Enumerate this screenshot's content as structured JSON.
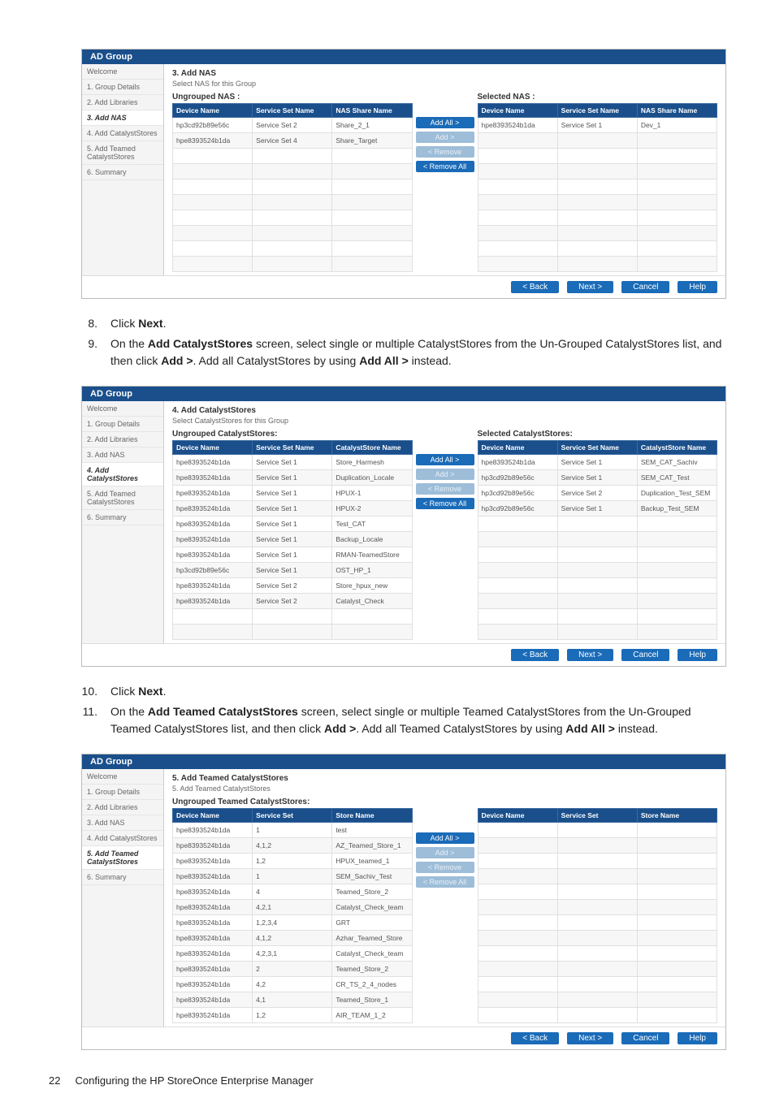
{
  "steps_text": {
    "s8_num": "8.",
    "s8_a": "Click ",
    "s8_b": "Next",
    "s8_c": ".",
    "s9_num": "9.",
    "s9_a": "On the ",
    "s9_b": "Add CatalystStores",
    "s9_c": " screen, select single or multiple CatalystStores from the Un-Grouped CatalystStores list, and then click ",
    "s9_d": "Add >",
    "s9_e": ". Add all CatalystStores by using ",
    "s9_f": "Add All >",
    "s9_g": " instead.",
    "s10_num": "10.",
    "s10_a": "Click ",
    "s10_b": "Next",
    "s10_c": ".",
    "s11_num": "11.",
    "s11_a": "On the ",
    "s11_b": "Add Teamed CatalystStores",
    "s11_c": " screen, select single or multiple Teamed CatalystStores from the Un-Grouped Teamed CatalystStores list, and then click ",
    "s11_d": "Add >",
    "s11_e": ". Add all Teamed CatalystStores by using ",
    "s11_f": "Add All >",
    "s11_g": " instead."
  },
  "wizard": {
    "title": "AD Group",
    "steps_sidebar": [
      "Welcome",
      "1. Group Details",
      "2. Add Libraries",
      "3. Add NAS",
      "4. Add CatalystStores",
      "5. Add Teamed CatalystStores",
      "6. Summary"
    ],
    "move_buttons": {
      "add_all": "Add All >",
      "add": "Add >",
      "remove": "< Remove",
      "remove_all": "< Remove All"
    },
    "footer_buttons": {
      "back": "< Back",
      "next": "Next >",
      "cancel": "Cancel",
      "help": "Help"
    }
  },
  "screen1": {
    "title": "3. Add NAS",
    "sub": "Select NAS for this Group",
    "left_label": "Ungrouped NAS :",
    "right_label": "Selected NAS :",
    "headers": [
      "Device Name",
      "Service Set Name",
      "NAS Share Name"
    ],
    "left_rows": [
      [
        "hp3cd92b89e56c",
        "Service Set 2",
        "Share_2_1"
      ],
      [
        "hpe8393524b1da",
        "Service Set 4",
        "Share_Target"
      ]
    ],
    "right_rows": [
      [
        "hpe8393524b1da",
        "Service Set 1",
        "Dev_1"
      ]
    ]
  },
  "screen2": {
    "title": "4. Add CatalystStores",
    "sub": "Select CatalystStores for this Group",
    "left_label": "Ungrouped CatalystStores:",
    "right_label": "Selected CatalystStores:",
    "headers": [
      "Device Name",
      "Service Set Name",
      "CatalystStore Name"
    ],
    "left_rows": [
      [
        "hpe8393524b1da",
        "Service Set 1",
        "Store_Harmesh"
      ],
      [
        "hpe8393524b1da",
        "Service Set 1",
        "Duplication_Locale"
      ],
      [
        "hpe8393524b1da",
        "Service Set 1",
        "HPUX-1"
      ],
      [
        "hpe8393524b1da",
        "Service Set 1",
        "HPUX-2"
      ],
      [
        "hpe8393524b1da",
        "Service Set 1",
        "Test_CAT"
      ],
      [
        "hpe8393524b1da",
        "Service Set 1",
        "Backup_Locale"
      ],
      [
        "hpe8393524b1da",
        "Service Set 1",
        "RMAN-TeamedStore"
      ],
      [
        "hp3cd92b89e56c",
        "Service Set 1",
        "OST_HP_1"
      ],
      [
        "hpe8393524b1da",
        "Service Set 2",
        "Store_hpux_new"
      ],
      [
        "hpe8393524b1da",
        "Service Set 2",
        "Catalyst_Check"
      ]
    ],
    "right_rows": [
      [
        "hpe8393524b1da",
        "Service Set 1",
        "SEM_CAT_Sachiv"
      ],
      [
        "hp3cd92b89e56c",
        "Service Set 1",
        "SEM_CAT_Test"
      ],
      [
        "hp3cd92b89e56c",
        "Service Set 2",
        "Duplication_Test_SEM"
      ],
      [
        "hp3cd92b89e56c",
        "Service Set 1",
        "Backup_Test_SEM"
      ]
    ]
  },
  "screen3": {
    "title": "5. Add Teamed CatalystStores",
    "sub": "5. Add Teamed CatalystStores",
    "left_label": "Ungrouped Teamed CatalystStores:",
    "right_label": "",
    "headers": [
      "Device Name",
      "Service Set",
      "Store Name"
    ],
    "left_rows": [
      [
        "hpe8393524b1da",
        "1",
        "test"
      ],
      [
        "hpe8393524b1da",
        "4,1,2",
        "AZ_Teamed_Store_1"
      ],
      [
        "hpe8393524b1da",
        "1,2",
        "HPUX_teamed_1"
      ],
      [
        "hpe8393524b1da",
        "1",
        "SEM_Sachiv_Test"
      ],
      [
        "hpe8393524b1da",
        "4",
        "Teamed_Store_2"
      ],
      [
        "hpe8393524b1da",
        "4,2,1",
        "Catalyst_Check_team"
      ],
      [
        "hpe8393524b1da",
        "1,2,3,4",
        "GRT"
      ],
      [
        "hpe8393524b1da",
        "4,1,2",
        "Azhar_Teamed_Store"
      ],
      [
        "hpe8393524b1da",
        "4,2,3,1",
        "Catalyst_Check_team"
      ],
      [
        "hpe8393524b1da",
        "2",
        "Teamed_Store_2"
      ],
      [
        "hpe8393524b1da",
        "4,2",
        "CR_TS_2_4_nodes"
      ],
      [
        "hpe8393524b1da",
        "4,1",
        "Teamed_Store_1"
      ],
      [
        "hpe8393524b1da",
        "1,2",
        "AIR_TEAM_1_2"
      ]
    ],
    "right_rows": []
  },
  "footer": {
    "page_num": "22",
    "page_title": "Configuring the HP StoreOnce Enterprise Manager"
  },
  "chart_data": {
    "type": "table",
    "note": "document page — no chart data"
  }
}
